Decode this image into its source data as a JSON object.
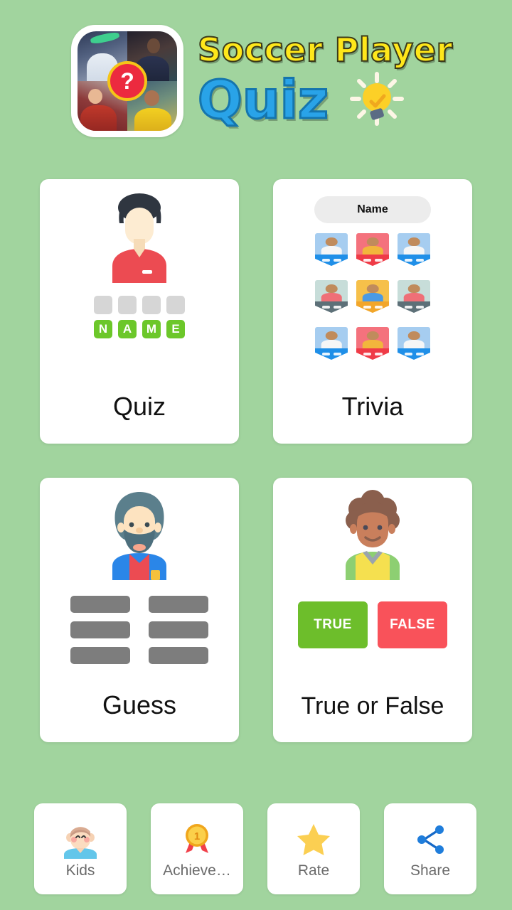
{
  "header": {
    "logo_name": "app-logo",
    "logo_question_mark": "?",
    "title_line1": "Soccer Player",
    "title_line2": "Quiz",
    "bulb_icon": "lightbulb-icon",
    "title_color_line1": "#ffe71a",
    "title_color_line2": "#29a3e8"
  },
  "theme": {
    "background": "#a1d49e",
    "card_background": "#ffffff",
    "accent_green": "#6cc72a",
    "accent_red": "#f9525a",
    "label_gray": "#6b6b6b"
  },
  "modes": [
    {
      "id": "quiz",
      "label": "Quiz",
      "art": "avatar-with-letter-tiles",
      "blank_tiles": 4,
      "letters": [
        "N",
        "A",
        "M",
        "E"
      ]
    },
    {
      "id": "trivia",
      "label": "Trivia",
      "art": "player-card-grid",
      "pill_label": "Name",
      "cards": [
        {
          "bg": "#a6cdf0",
          "shirt": "#f6f6f6",
          "band": "#1f8fe8"
        },
        {
          "bg": "#f4727d",
          "shirt": "#f2b63c",
          "band": "#ef3b47"
        },
        {
          "bg": "#a6cdf0",
          "shirt": "#f6f6f6",
          "band": "#1f8fe8"
        },
        {
          "bg": "#c7ddd9",
          "shirt": "#ef6f77",
          "band": "#5d7078"
        },
        {
          "bg": "#f6c04a",
          "shirt": "#4b9ae4",
          "band": "#f2a62a"
        },
        {
          "bg": "#c7ddd9",
          "shirt": "#ef6f77",
          "band": "#5d7078"
        },
        {
          "bg": "#a6cdf0",
          "shirt": "#f6f6f6",
          "band": "#1f8fe8"
        },
        {
          "bg": "#f4727d",
          "shirt": "#f2b63c",
          "band": "#ef3b47"
        },
        {
          "bg": "#a6cdf0",
          "shirt": "#f6f6f6",
          "band": "#1f8fe8"
        }
      ]
    },
    {
      "id": "guess",
      "label": "Guess",
      "art": "bearded-avatar-with-bars",
      "bars": 6
    },
    {
      "id": "true_or_false",
      "label": "True or False",
      "art": "avatar-with-true-false-buttons",
      "true_label": "TRUE",
      "false_label": "FALSE"
    }
  ],
  "bottom_nav": [
    {
      "id": "kids",
      "label": "Kids",
      "icon": "kid-face-icon"
    },
    {
      "id": "achievement",
      "label": "Achieve…",
      "icon": "medal-icon",
      "medal_rank": "1"
    },
    {
      "id": "rate",
      "label": "Rate",
      "icon": "star-icon"
    },
    {
      "id": "share",
      "label": "Share",
      "icon": "share-icon"
    }
  ]
}
